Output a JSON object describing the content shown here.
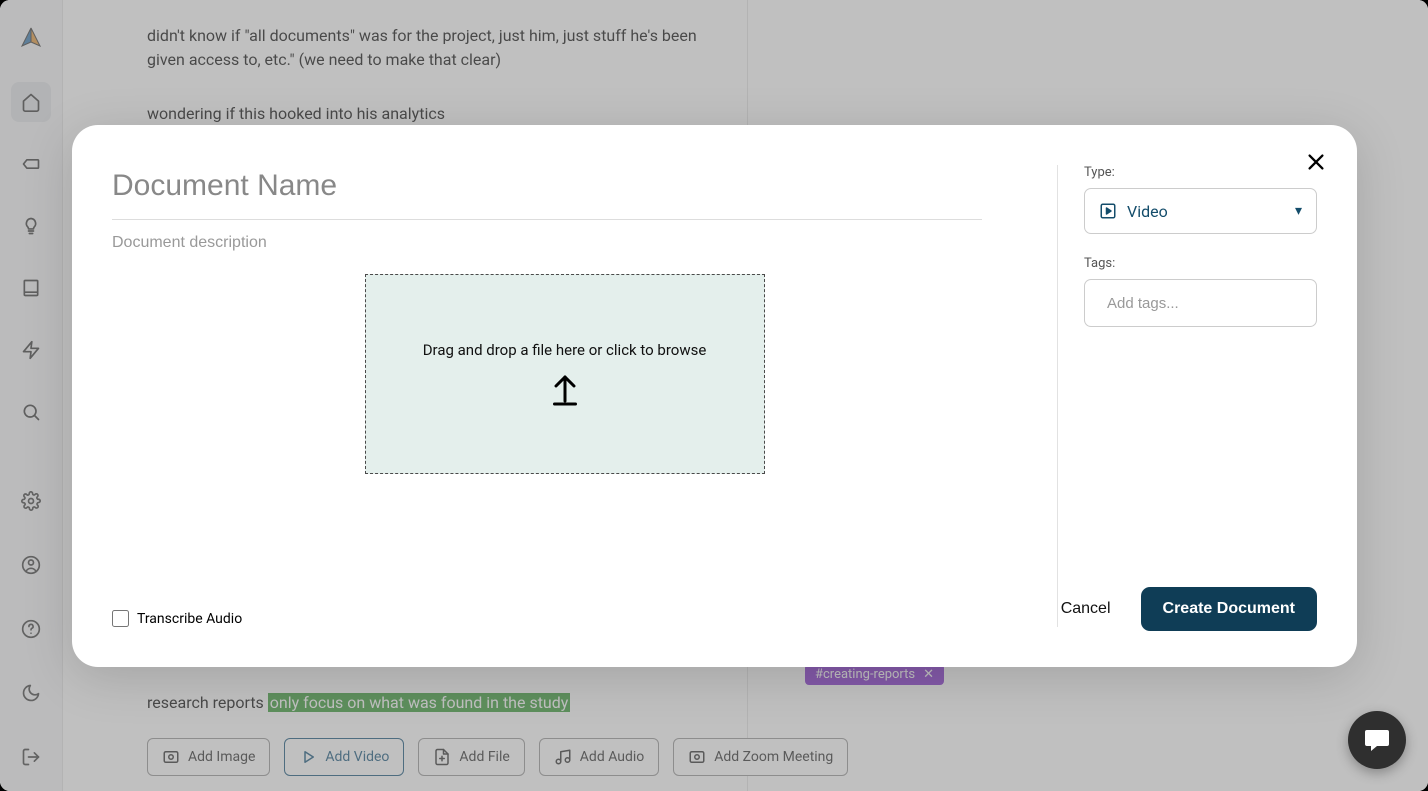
{
  "background_doc": {
    "para1": "didn't know if \"all documents\" was for the project, just him, just stuff he's been given access to, etc.\" (we need to make that clear)",
    "para2": "wondering if this hooked into his analytics",
    "last_line_prefix": "research reports ",
    "last_line_highlight": "only focus on what was found in the study"
  },
  "add_buttons": {
    "image": "Add Image",
    "video": "Add Video",
    "file": "Add File",
    "audio": "Add Audio",
    "zoom": "Add Zoom Meeting"
  },
  "tag_chip": "#creating-reports",
  "modal": {
    "name_placeholder": "Document Name",
    "desc_placeholder": "Document description",
    "dropzone": "Drag and drop a file here or click to browse",
    "transcribe": "Transcribe Audio",
    "type_label": "Type:",
    "type_value": "Video",
    "tags_label": "Tags:",
    "tags_placeholder": "Add tags...",
    "cancel": "Cancel",
    "create": "Create Document"
  }
}
